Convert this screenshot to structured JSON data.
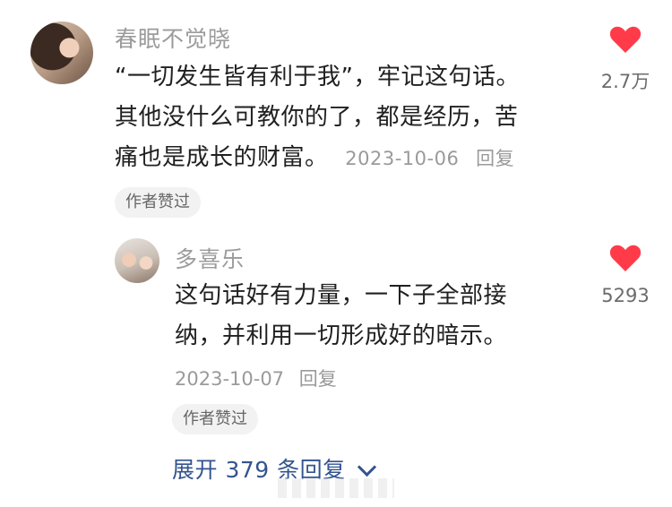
{
  "comment": {
    "username": "春眠不觉晓",
    "lines": [
      "“一切发生皆有利于我”，牢记这句话。",
      "其他没什么可教你的了，都是经历，苦",
      "痛也是成长的财富。"
    ],
    "date": "2023-10-06",
    "reply_label": "回复",
    "badge": "作者赞过",
    "likes": "2.7万",
    "heart_icon": "heart-icon",
    "heart_color": "#ff3b4a"
  },
  "reply": {
    "username": "多喜乐",
    "lines": [
      "这句话好有力量，一下子全部接",
      "纳，并利用一切形成好的暗示。"
    ],
    "date": "2023-10-07",
    "reply_label": "回复",
    "badge": "作者赞过",
    "likes": "5293",
    "heart_icon": "heart-icon",
    "heart_color": "#ff3b4a"
  },
  "expand": {
    "label": "展开 379 条回复",
    "icon": "chevron-down-icon",
    "color": "#33548f"
  }
}
